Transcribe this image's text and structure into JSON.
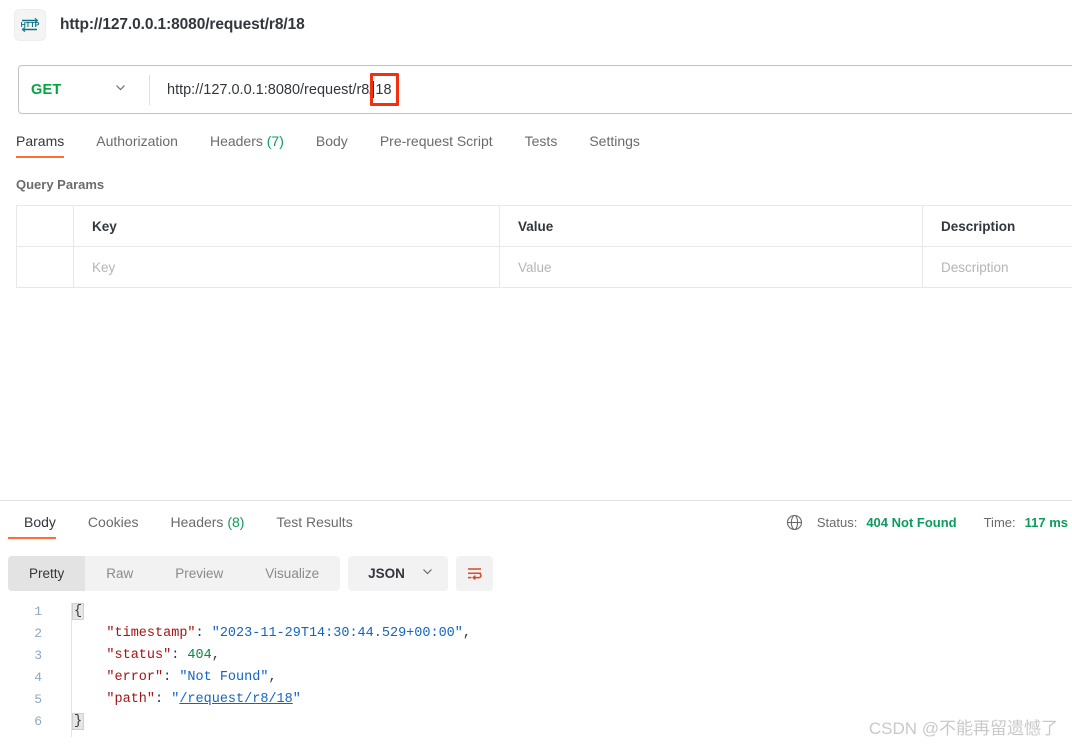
{
  "window": {
    "title": "http://127.0.0.1:8080/request/r8/18",
    "icon": "http-icon"
  },
  "request_bar": {
    "method": "GET",
    "method_dropdown_icon": "chevron-down-icon",
    "url_prefix": "http://127.0.0.1:8080/request/r8/",
    "url_highlighted": "18",
    "full_url": "http://127.0.0.1:8080/request/r8/18",
    "annotation_color": "#f52e10"
  },
  "request_tabs": [
    {
      "label": "Params",
      "active": true
    },
    {
      "label": "Authorization",
      "active": false
    },
    {
      "label": "Headers",
      "count": "(7)",
      "active": false
    },
    {
      "label": "Body",
      "active": false
    },
    {
      "label": "Pre-request Script",
      "active": false
    },
    {
      "label": "Tests",
      "active": false
    },
    {
      "label": "Settings",
      "active": false
    }
  ],
  "query_params": {
    "section_title": "Query Params",
    "headers": [
      "",
      "Key",
      "Value",
      "Description"
    ],
    "rows": [
      {
        "key": "Key",
        "value": "Value",
        "description": "Description"
      }
    ]
  },
  "response_tabs": [
    {
      "label": "Body",
      "active": true
    },
    {
      "label": "Cookies",
      "active": false
    },
    {
      "label": "Headers",
      "count": "(8)",
      "active": false
    },
    {
      "label": "Test Results",
      "active": false
    }
  ],
  "response_meta": {
    "globe_icon": "globe-icon",
    "status_label": "Status:",
    "status_value": "404 Not Found",
    "time_label": "Time:",
    "time_value": "117 ms",
    "status_color": "#0b9c5f"
  },
  "response_toolbar": {
    "views": [
      {
        "label": "Pretty",
        "active": true
      },
      {
        "label": "Raw",
        "active": false
      },
      {
        "label": "Preview",
        "active": false
      },
      {
        "label": "Visualize",
        "active": false
      }
    ],
    "format": "JSON",
    "format_dropdown_icon": "chevron-down-icon",
    "wrap_icon": "word-wrap-icon"
  },
  "response_body": {
    "language": "json",
    "lines": [
      {
        "n": "1",
        "open_brace": "{"
      },
      {
        "n": "2",
        "key": "\"timestamp\"",
        "sep": ": ",
        "value": "\"2023-11-29T14:30:44.529+00:00\"",
        "type": "string",
        "trail": ","
      },
      {
        "n": "3",
        "key": "\"status\"",
        "sep": ": ",
        "value": "404",
        "type": "number",
        "trail": ","
      },
      {
        "n": "4",
        "key": "\"error\"",
        "sep": ": ",
        "value": "\"Not Found\"",
        "type": "string",
        "trail": ","
      },
      {
        "n": "5",
        "key": "\"path\"",
        "sep": ": ",
        "value": "/request/r8/18",
        "type": "link",
        "trail": ""
      },
      {
        "n": "6",
        "close_brace": "}"
      }
    ],
    "parsed": {
      "timestamp": "2023-11-29T14:30:44.529+00:00",
      "status": 404,
      "error": "Not Found",
      "path": "/request/r8/18"
    }
  },
  "watermark": {
    "text": "CSDN @不能再留遗憾了"
  }
}
